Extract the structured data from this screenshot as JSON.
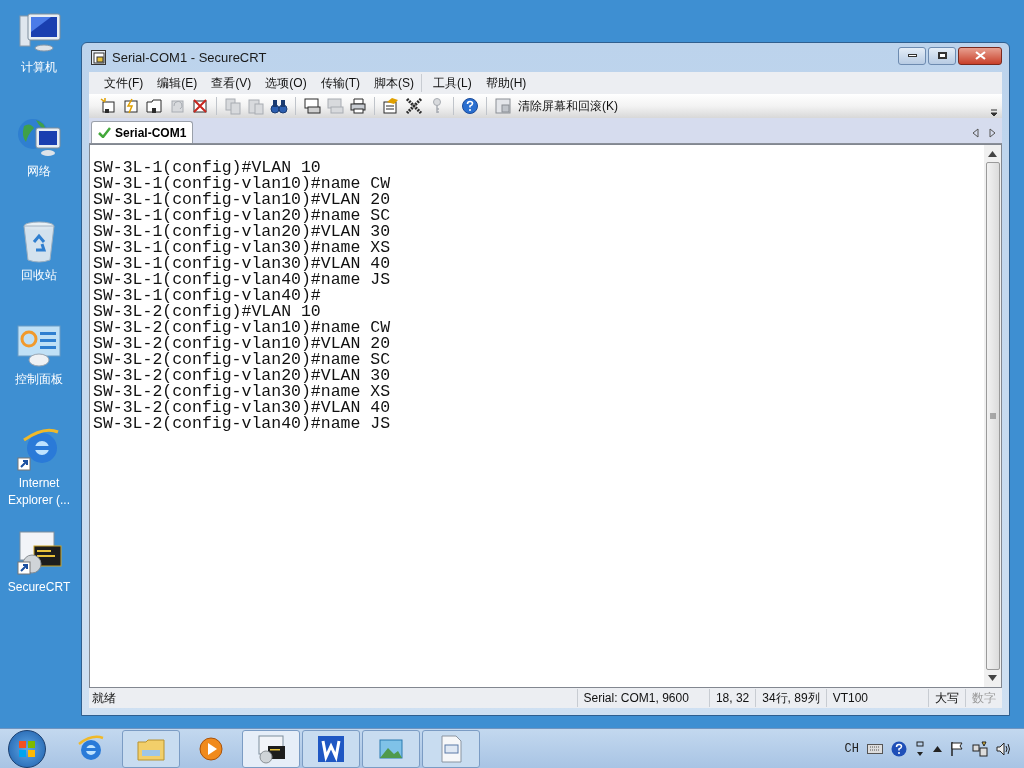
{
  "desktop_icons": [
    {
      "kind": "computer",
      "label": "计算机"
    },
    {
      "kind": "network",
      "label": "网络"
    },
    {
      "kind": "recycle",
      "label": "回收站"
    },
    {
      "kind": "control",
      "label": "控制面板"
    },
    {
      "kind": "ie",
      "label": "Internet Explorer (..."
    },
    {
      "kind": "securecrt",
      "label": "SecureCRT"
    }
  ],
  "window": {
    "title": "Serial-COM1 - SecureCRT"
  },
  "menu": [
    "文件(F)",
    "编辑(E)",
    "查看(V)",
    "选项(O)",
    "传输(T)",
    "脚本(S)",
    "工具(L)",
    "帮助(H)"
  ],
  "toolbar": [
    {
      "kind": "connect",
      "disabled": false
    },
    {
      "kind": "quick-connect",
      "disabled": false
    },
    {
      "kind": "tab-connect",
      "disabled": false
    },
    {
      "kind": "reconnect",
      "disabled": true
    },
    {
      "kind": "disconnect",
      "disabled": false
    },
    {
      "kind": "sep"
    },
    {
      "kind": "copy",
      "disabled": true
    },
    {
      "kind": "paste",
      "disabled": true
    },
    {
      "kind": "find",
      "disabled": false
    },
    {
      "kind": "sep"
    },
    {
      "kind": "print-screen",
      "disabled": false
    },
    {
      "kind": "print-selection",
      "disabled": true
    },
    {
      "kind": "print",
      "disabled": false
    },
    {
      "kind": "sep"
    },
    {
      "kind": "session-options",
      "disabled": false
    },
    {
      "kind": "global-options",
      "disabled": false
    },
    {
      "kind": "key",
      "disabled": true
    },
    {
      "kind": "sep"
    },
    {
      "kind": "help",
      "disabled": false
    },
    {
      "kind": "sep"
    },
    {
      "kind": "clear",
      "disabled": false,
      "label": "清除屏幕和回滚(K)"
    }
  ],
  "tabs": [
    {
      "label": "Serial-COM1",
      "selected": true,
      "connected": true
    }
  ],
  "terminal": {
    "lines": [
      "SW-3L-1(config)#VLAN 10",
      "SW-3L-1(config-vlan10)#name CW",
      "SW-3L-1(config-vlan10)#VLAN 20",
      "SW-3L-1(config-vlan20)#name SC",
      "SW-3L-1(config-vlan20)#VLAN 30",
      "SW-3L-1(config-vlan30)#name XS",
      "SW-3L-1(config-vlan30)#VLAN 40",
      "SW-3L-1(config-vlan40)#name JS",
      "SW-3L-1(config-vlan40)#",
      "SW-3L-2(config)#VLAN 10",
      "SW-3L-2(config-vlan10)#name CW",
      "SW-3L-2(config-vlan10)#VLAN 20",
      "SW-3L-2(config-vlan20)#name SC",
      "SW-3L-2(config-vlan20)#VLAN 30",
      "SW-3L-2(config-vlan30)#name XS",
      "SW-3L-2(config-vlan30)#VLAN 40",
      "SW-3L-2(config-vlan40)#name JS"
    ]
  },
  "status_bar": {
    "message": "就绪",
    "fields": [
      {
        "text": "Serial: COM1, 9600",
        "disabled": false
      },
      {
        "text": "18,  32",
        "disabled": false
      },
      {
        "text": "34行, 89列",
        "disabled": false
      },
      {
        "text": "VT100",
        "disabled": false
      },
      {
        "text": "大写",
        "disabled": false
      },
      {
        "text": "数字",
        "disabled": true
      }
    ]
  },
  "taskbar": {
    "items": [
      {
        "kind": "ie",
        "running": false,
        "selected": false
      },
      {
        "kind": "folder",
        "running": true,
        "selected": false
      },
      {
        "kind": "media",
        "running": false,
        "selected": false
      },
      {
        "kind": "securecrt",
        "running": true,
        "selected": true
      },
      {
        "kind": "wps",
        "running": true,
        "selected": false
      },
      {
        "kind": "photo",
        "running": true,
        "selected": false
      },
      {
        "kind": "document",
        "running": true,
        "selected": false
      }
    ],
    "language": "CH"
  }
}
